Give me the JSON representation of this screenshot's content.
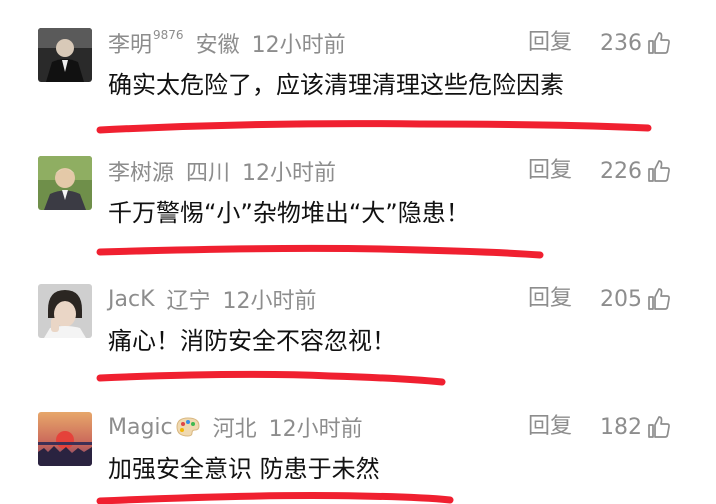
{
  "comments": [
    {
      "username": "李明",
      "username_sup": "9876",
      "location": "安徽",
      "time": "12小时前",
      "reply_label": "回复",
      "likes": "236",
      "text": "确实太危险了，应该清理清理这些危险因素",
      "avatar_icon": "avatar-dark-suit"
    },
    {
      "username": "李树源",
      "location": "四川",
      "time": "12小时前",
      "reply_label": "回复",
      "likes": "226",
      "text": "千万警惕“小”杂物堆出“大”隐患！",
      "avatar_icon": "avatar-elderly-man"
    },
    {
      "username": "JacK",
      "location": "辽宁",
      "time": "12小时前",
      "reply_label": "回复",
      "likes": "205",
      "text": "痛心！消防安全不容忽视！",
      "avatar_icon": "avatar-young-person"
    },
    {
      "username": "Magic",
      "location": "河北",
      "time": "12小时前",
      "reply_label": "回复",
      "likes": "182",
      "text": "加强安全意识 防患于未然",
      "avatar_icon": "avatar-sunset-landscape",
      "badge_icon": "palette-emoji-icon"
    }
  ],
  "colors": {
    "meta_text": "#8d8d8d",
    "body_text": "#111111",
    "underline": "#f02030"
  }
}
